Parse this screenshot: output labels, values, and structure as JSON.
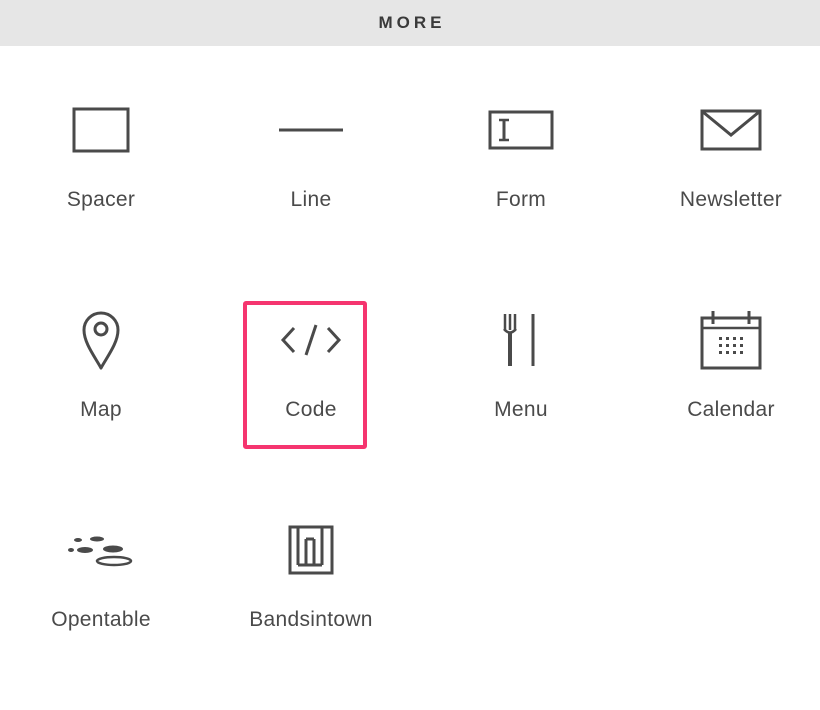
{
  "header": {
    "title": "MORE"
  },
  "items": [
    {
      "label": "Spacer",
      "icon": "spacer-icon"
    },
    {
      "label": "Line",
      "icon": "line-icon"
    },
    {
      "label": "Form",
      "icon": "form-icon"
    },
    {
      "label": "Newsletter",
      "icon": "envelope-icon"
    },
    {
      "label": "Map",
      "icon": "map-pin-icon"
    },
    {
      "label": "Code",
      "icon": "code-icon",
      "highlighted": true
    },
    {
      "label": "Menu",
      "icon": "fork-knife-icon"
    },
    {
      "label": "Calendar",
      "icon": "calendar-icon"
    },
    {
      "label": "Opentable",
      "icon": "opentable-icon"
    },
    {
      "label": "Bandsintown",
      "icon": "bandsintown-icon"
    }
  ],
  "colors": {
    "header_bg": "#e6e6e6",
    "icon_stroke": "#4a4a4a",
    "highlight": "#f5356f"
  }
}
